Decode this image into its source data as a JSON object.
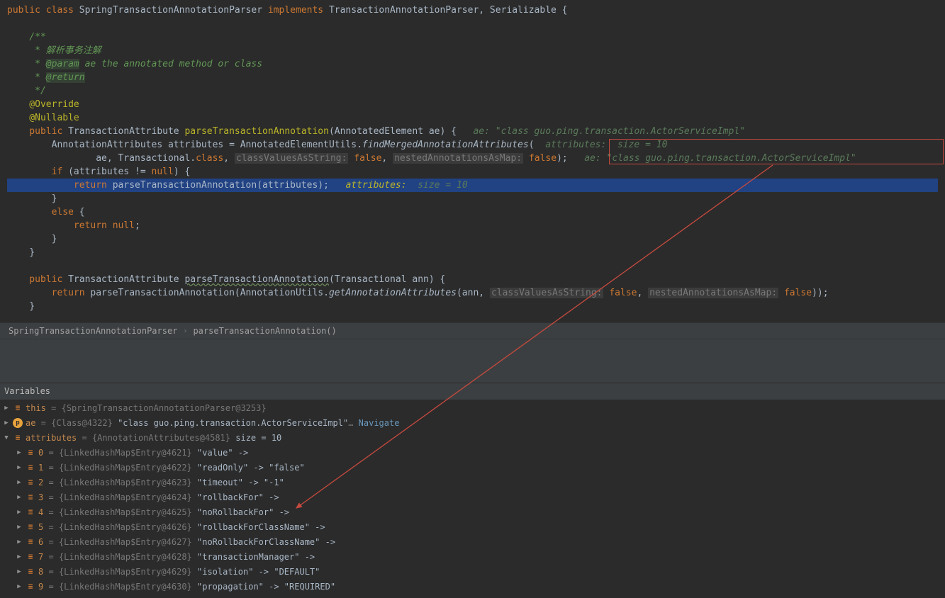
{
  "code": {
    "l1": {
      "p1": "public class ",
      "p2": "SpringTransactionAnnotationParser ",
      "p3": "implements ",
      "p4": "TransactionAnnotationParser, Serializable {"
    },
    "l2": "",
    "l3": "    /**",
    "l4": "     * 解析事务注解",
    "l5": {
      "p1": "     * ",
      "p2": "@param",
      "p3": " ae the annotated method or class"
    },
    "l6": {
      "p1": "     * ",
      "p2": "@return"
    },
    "l7": "     */",
    "l8": "    @Override",
    "l9": "    @Nullable",
    "l10": {
      "p1": "    public ",
      "p2": "TransactionAttribute ",
      "p3": "parseTransactionAnnotation",
      "p4": "(AnnotatedElement ae) {",
      "p5": "   ae: \"class guo.ping.transaction.ActorServiceImpl\""
    },
    "l11": {
      "p1": "        AnnotationAttributes attributes = AnnotatedElementUtils.",
      "p2": "findMergedAnnotationAttributes",
      "p3": "(  ",
      "p4": "attributes:  size = 10"
    },
    "l12": {
      "p1": "                ae, Transactional.",
      "p2": "class",
      "p3": ", ",
      "h1": "classValuesAsString:",
      "p4": " false",
      "p5": ", ",
      "h2": "nestedAnnotationsAsMap:",
      "p6": " false",
      "p7": ");   ",
      "p8": "ae: \"class guo.ping.transaction.ActorServiceImpl\""
    },
    "l13": {
      "p1": "        if ",
      "p2": "(attributes != ",
      "p3": "null",
      "p4": ") {"
    },
    "l14": {
      "p1": "            return ",
      "p2": "parseTransactionAnnotation(attributes);  ",
      "p3": " attributes:",
      "p4": "  size = 10"
    },
    "l15": "        }",
    "l16": {
      "p1": "        else ",
      "p2": "{"
    },
    "l17": {
      "p1": "            return null",
      "p2": ";"
    },
    "l18": "        }",
    "l19": "    }",
    "l20": "",
    "l21": {
      "p1": "    public ",
      "p2": "TransactionAttribute ",
      "p3": "parseTransactionAnnotation",
      "p4": "(Transactional ann) {"
    },
    "l22": {
      "p1": "        return ",
      "p2": "parseTransactionAnnotation(AnnotationUtils.",
      "p3": "getAnnotationAttributes",
      "p4": "(ann, ",
      "h1": "classValuesAsString:",
      "p5": " false",
      "p6": ", ",
      "h2": "nestedAnnotationsAsMap:",
      "p7": " false",
      "p8": "));"
    },
    "l23": "    }"
  },
  "breadcrumb": {
    "item1": "SpringTransactionAnnotationParser",
    "sep": "›",
    "item2": "parseTransactionAnnotation()"
  },
  "variables_header": "Variables",
  "vars": {
    "this": {
      "name": "this",
      "eq": " = ",
      "type": "{SpringTransactionAnnotationParser@3253}"
    },
    "ae": {
      "name": "ae",
      "eq": " = ",
      "type": "{Class@4322}",
      "val": " \"class guo.ping.transaction.ActorServiceImpl\"",
      "dots": "… ",
      "link": "Navigate"
    },
    "attributes": {
      "name": "attributes",
      "eq": " = ",
      "type": "{AnnotationAttributes@4581}",
      "val": "  size = 10"
    },
    "entries": [
      {
        "idx": "0",
        "type": "{LinkedHashMap$Entry@4621}",
        "val": " \"value\" -> "
      },
      {
        "idx": "1",
        "type": "{LinkedHashMap$Entry@4622}",
        "val": " \"readOnly\" -> \"false\""
      },
      {
        "idx": "2",
        "type": "{LinkedHashMap$Entry@4623}",
        "val": " \"timeout\" -> \"-1\""
      },
      {
        "idx": "3",
        "type": "{LinkedHashMap$Entry@4624}",
        "val": " \"rollbackFor\" -> "
      },
      {
        "idx": "4",
        "type": "{LinkedHashMap$Entry@4625}",
        "val": " \"noRollbackFor\" -> "
      },
      {
        "idx": "5",
        "type": "{LinkedHashMap$Entry@4626}",
        "val": " \"rollbackForClassName\" -> "
      },
      {
        "idx": "6",
        "type": "{LinkedHashMap$Entry@4627}",
        "val": " \"noRollbackForClassName\" -> "
      },
      {
        "idx": "7",
        "type": "{LinkedHashMap$Entry@4628}",
        "val": " \"transactionManager\" -> "
      },
      {
        "idx": "8",
        "type": "{LinkedHashMap$Entry@4629}",
        "val": " \"isolation\" -> \"DEFAULT\""
      },
      {
        "idx": "9",
        "type": "{LinkedHashMap$Entry@4630}",
        "val": " \"propagation\" -> \"REQUIRED\""
      }
    ]
  }
}
